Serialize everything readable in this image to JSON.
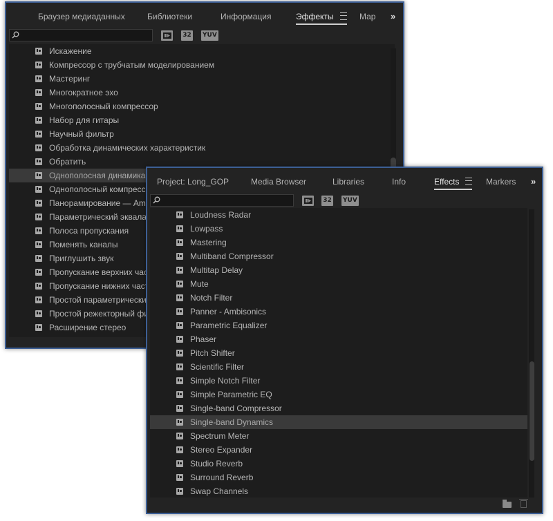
{
  "ru_panel": {
    "tabs": [
      "Браузер медиаданных",
      "Библиотеки",
      "Информация",
      "Эффекты",
      "Мар"
    ],
    "active_tab": "Эффекты",
    "search": {
      "value": "",
      "placeholder": ""
    },
    "toolbar_buttons": [
      "32",
      "YUV"
    ],
    "items": [
      "Искажение",
      "Компрессор с трубчатым моделированием",
      "Мастеринг",
      "Многократное эхо",
      "Многополосный компрессор",
      "Набор для гитары",
      "Научный фильтр",
      "Обработка динамических характеристик",
      "Обратить",
      "Однополосная динамика",
      "Однополосный компрессор",
      "Панорамирование — Ambisonics",
      "Параметрический эквалайзер",
      "Полоса пропускания",
      "Поменять каналы",
      "Приглушить звук",
      "Пропускание верхних частот",
      "Пропускание нижних частот",
      "Простой параметрический эквалайзер",
      "Простой режекторный фильтр",
      "Расширение стерео"
    ],
    "selected_item": "Однополосная динамика"
  },
  "en_panel": {
    "tabs": [
      "Project: Long_GOP",
      "Media Browser",
      "Libraries",
      "Info",
      "Effects",
      "Markers"
    ],
    "active_tab": "Effects",
    "search": {
      "value": "",
      "placeholder": ""
    },
    "toolbar_buttons": [
      "32",
      "YUV"
    ],
    "items": [
      "Loudness Radar",
      "Lowpass",
      "Mastering",
      "Multiband Compressor",
      "Multitap Delay",
      "Mute",
      "Notch Filter",
      "Panner - Ambisonics",
      "Parametric Equalizer",
      "Phaser",
      "Pitch Shifter",
      "Scientific Filter",
      "Simple Notch Filter",
      "Simple Parametric EQ",
      "Single-band Compressor",
      "Single-band Dynamics",
      "Spectrum Meter",
      "Stereo Expander",
      "Studio Reverb",
      "Surround Reverb",
      "Swap Channels"
    ],
    "selected_item": "Single-band Dynamics"
  },
  "overflow_glyph": "»",
  "colors": {
    "panel_bg": "#232323",
    "list_bg": "#1d1d1d",
    "selection": "#3a3a3a",
    "window_border": "#3d5f95",
    "text": "#b6b6b6"
  }
}
